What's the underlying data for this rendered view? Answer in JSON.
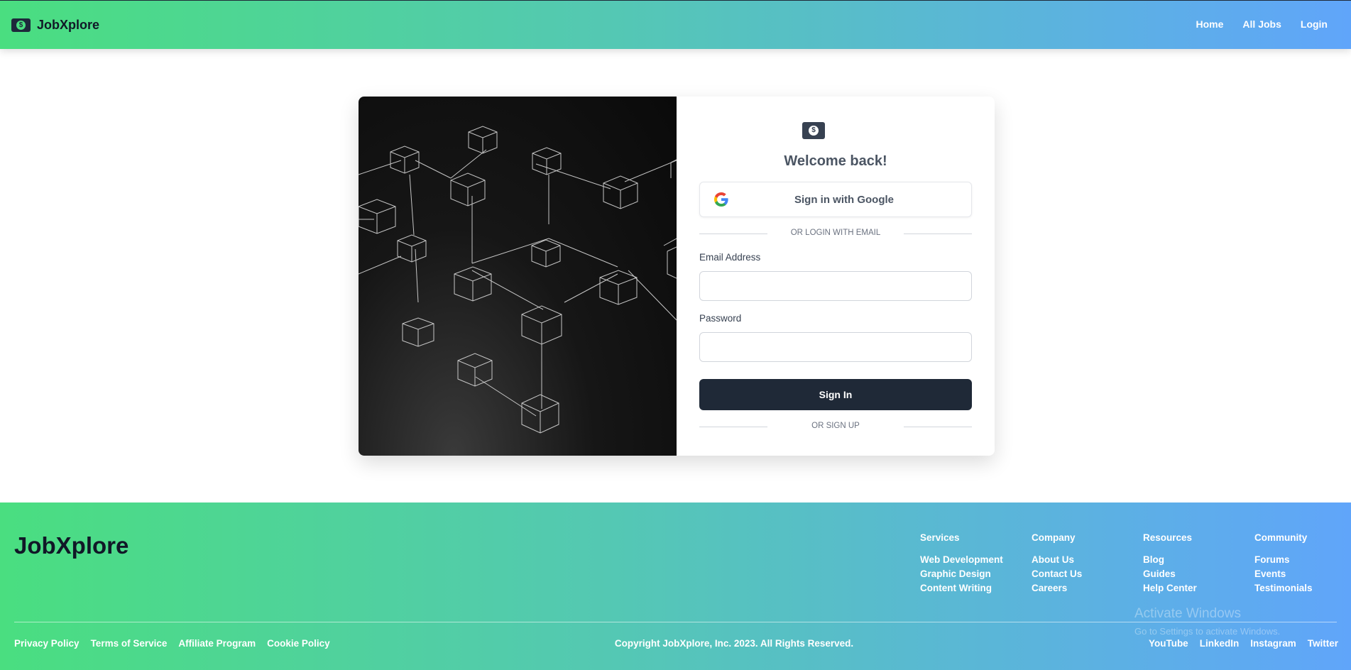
{
  "header": {
    "brand": "JobXplore",
    "nav": [
      {
        "label": "Home"
      },
      {
        "label": "All Jobs"
      },
      {
        "label": "Login"
      }
    ]
  },
  "login": {
    "welcome": "Welcome back!",
    "google_button": "Sign in with Google",
    "divider_email": "OR LOGIN WITH EMAIL",
    "email_label": "Email Address",
    "email_value": "",
    "password_label": "Password",
    "password_value": "",
    "signin_button": "Sign In",
    "divider_signup": "OR SIGN UP"
  },
  "footer": {
    "brand": "JobXplore",
    "columns": [
      {
        "heading": "Services",
        "links": [
          "Web Development",
          "Graphic Design",
          "Content Writing"
        ]
      },
      {
        "heading": "Company",
        "links": [
          "About Us",
          "Contact Us",
          "Careers"
        ]
      },
      {
        "heading": "Resources",
        "links": [
          "Blog",
          "Guides",
          "Help Center"
        ]
      },
      {
        "heading": "Community",
        "links": [
          "Forums",
          "Events",
          "Testimonials"
        ]
      }
    ],
    "legal_links": [
      "Privacy Policy",
      "Terms of Service",
      "Affiliate Program",
      "Cookie Policy"
    ],
    "copyright": "Copyright JobXplore, Inc. 2023. All Rights Reserved.",
    "social_links": [
      "YouTube",
      "LinkedIn",
      "Instagram",
      "Twitter"
    ]
  },
  "watermark": {
    "line1": "Activate Windows",
    "line2": "Go to Settings to activate Windows."
  },
  "colors": {
    "gradient_start": "#4ade80",
    "gradient_end": "#60a5fa",
    "primary_button": "#1f2937"
  }
}
